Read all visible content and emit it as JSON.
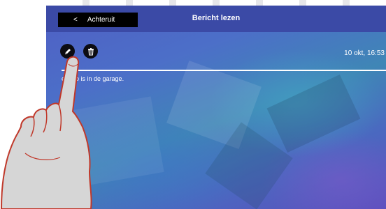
{
  "header": {
    "back_label": "Achteruit",
    "title": "Bericht lezen"
  },
  "message": {
    "timestamp": "10 okt, 16:53",
    "body": "e auto is in de garage."
  },
  "icons": {
    "back": "chevron-left-icon",
    "edit": "pencil-icon",
    "delete": "trash-icon"
  },
  "colors": {
    "header_bar": "#3b4aa6",
    "button_bg": "#000000",
    "text": "#ffffff"
  }
}
